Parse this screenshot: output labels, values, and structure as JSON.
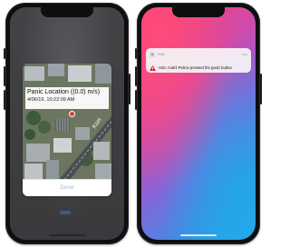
{
  "left_phone": {
    "alert": {
      "title": "Panic Location ((0.0) m/s)",
      "timestamp": "4/06/19, 10:22:09 AM",
      "map_street_label": "Kon",
      "done_label": "Done"
    }
  },
  "right_phone": {
    "notification": {
      "app_name": "HUB",
      "time": "now",
      "message": "Hub: Andrii Petrov pressed the panic button"
    }
  },
  "colors": {
    "alert_pin": "#e23a2d",
    "done_text": "#a7b4c6",
    "warning": "#e0242c",
    "wallpaper_top": "#ff3f6e",
    "wallpaper_bottom": "#22b5ee"
  },
  "icons": [
    "warning-triangle-icon",
    "app-icon",
    "map-pin-icon"
  ]
}
